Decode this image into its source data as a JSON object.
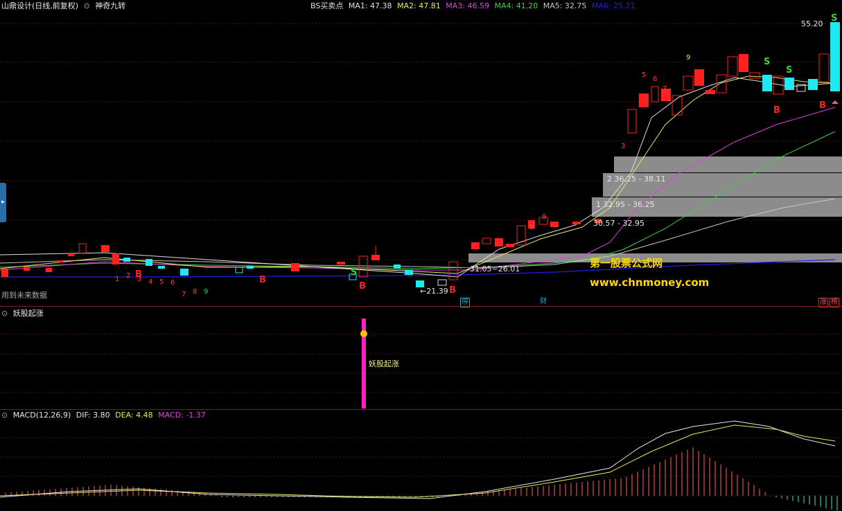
{
  "header": {
    "title": "山鼎设计(日线,前复权)",
    "indicator_name": "神奇九转",
    "bs_label": "BS买卖点",
    "ma": [
      {
        "label": "MA1: 47.38",
        "color": "#e0e0e0"
      },
      {
        "label": "MA2: 47.81",
        "color": "#e8e860"
      },
      {
        "label": "MA3: 46.59",
        "color": "#e040e0"
      },
      {
        "label": "MA4: 41.20",
        "color": "#40d040"
      },
      {
        "label": "MA5: 32.75",
        "color": "#c8c8c8"
      },
      {
        "label": "MA6: 25.21",
        "color": "#2020e0"
      }
    ]
  },
  "main": {
    "price_high_label": "55.20",
    "low_label": "←21.39",
    "note_future": "用到未来数据",
    "levels": [
      {
        "label": "30.57 - 32.95"
      },
      {
        "label": "1  32.95 - 36.25"
      },
      {
        "label": "2  36.25 - 38.11"
      },
      {
        "label": "31.05~26.01"
      }
    ],
    "watermark_cn": "第一股票公式网",
    "watermark_url": "www.chnmoney.com",
    "bottom_badges": [
      {
        "text": "停",
        "color": "#2aa8c8"
      },
      {
        "text": "财",
        "color": "#2aa8c8"
      },
      {
        "text": "涨",
        "color": "#c83030"
      },
      {
        "text": "榜",
        "color": "#c83030"
      }
    ]
  },
  "panel2": {
    "title": "妖股起涨",
    "signal_label": "妖股起涨"
  },
  "panel3": {
    "title": "MACD(12,26,9)",
    "dif": "DIF: 3.80",
    "dea": "DEA: 4.48",
    "macd": "MACD: -1.37",
    "macd_color": "#e040e0"
  },
  "colors": {
    "up": "#ff2020",
    "down": "#20e8f0",
    "bg": "#000000"
  }
}
